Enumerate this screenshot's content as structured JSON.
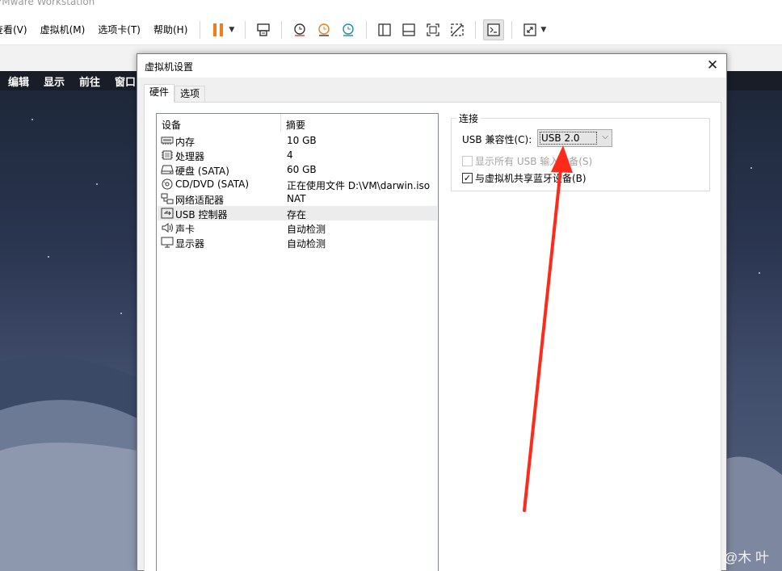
{
  "app": {
    "title": "VMware Workstation",
    "menu": [
      "查看(V)",
      "虚拟机(M)",
      "选项卡(T)",
      "帮助(H)"
    ]
  },
  "guest": {
    "menubar": [
      "编辑",
      "显示",
      "前往",
      "窗口"
    ]
  },
  "dialog": {
    "title": "虚拟机设置",
    "tabs": [
      "硬件",
      "选项"
    ],
    "device_list": {
      "columns": [
        "设备",
        "摘要"
      ],
      "rows": [
        {
          "name": "内存",
          "summary": "10 GB",
          "icon": "memory-icon"
        },
        {
          "name": "处理器",
          "summary": "4",
          "icon": "cpu-icon"
        },
        {
          "name": "硬盘 (SATA)",
          "summary": "60 GB",
          "icon": "hard-disk-icon"
        },
        {
          "name": "CD/DVD (SATA)",
          "summary": "正在使用文件 D:\\VM\\darwin.iso",
          "icon": "cd-dvd-icon"
        },
        {
          "name": "网络适配器",
          "summary": "NAT",
          "icon": "network-adapter-icon"
        },
        {
          "name": "USB 控制器",
          "summary": "存在",
          "icon": "usb-icon"
        },
        {
          "name": "声卡",
          "summary": "自动检测",
          "icon": "sound-icon"
        },
        {
          "name": "显示器",
          "summary": "自动检测",
          "icon": "display-icon"
        }
      ],
      "selected_index": 5
    },
    "connection": {
      "legend": "连接",
      "usb_compat_label": "USB 兼容性(C):",
      "usb_compat_value": "USB 2.0",
      "show_all_usb_label": "显示所有 USB 输入设备(S)",
      "show_all_usb_checked": false,
      "show_all_usb_enabled": false,
      "share_bluetooth_label": "与虚拟机共享蓝牙设备(B)",
      "share_bluetooth_checked": true
    }
  },
  "watermark": "CSDN @木 叶",
  "colors": {
    "accent_orange": "#f07c1e",
    "annotation_red": "#ff2a1a",
    "selection": "#ececec"
  }
}
